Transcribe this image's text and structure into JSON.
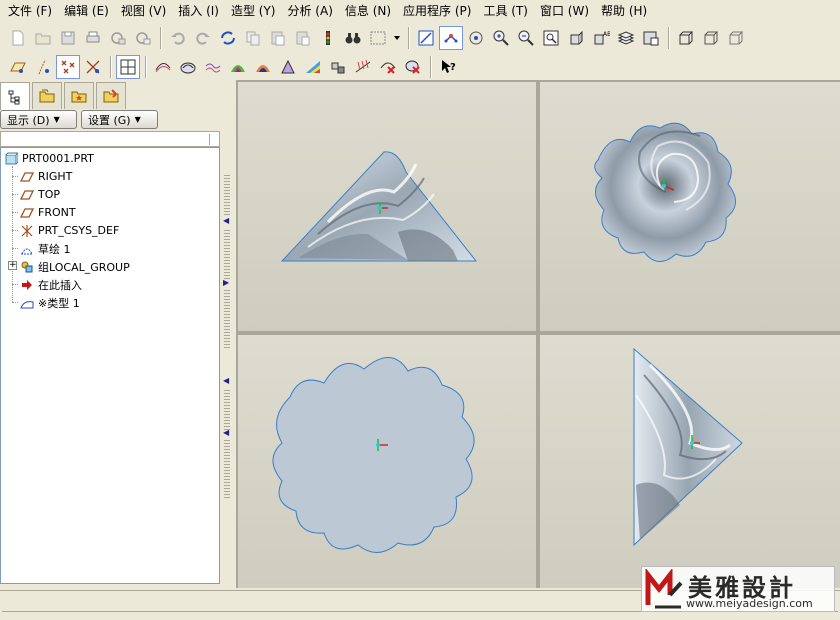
{
  "menu": [
    "文件 (F)",
    "编辑 (E)",
    "视图 (V)",
    "插入 (I)",
    "造型 (Y)",
    "分析 (A)",
    "信息 (N)",
    "应用程序 (P)",
    "工具 (T)",
    "窗口 (W)",
    "帮助 (H)"
  ],
  "panel": {
    "show_button": "显示 (D)",
    "settings_button": "设置 (G)"
  },
  "tree": {
    "items": [
      {
        "label": "PRT0001.PRT",
        "icon": "part-icon"
      },
      {
        "label": "RIGHT",
        "icon": "datum-plane-icon"
      },
      {
        "label": "TOP",
        "icon": "datum-plane-icon"
      },
      {
        "label": "FRONT",
        "icon": "datum-plane-icon"
      },
      {
        "label": "PRT_CSYS_DEF",
        "icon": "csys-icon"
      },
      {
        "label": "草绘 1",
        "icon": "sketch-icon"
      },
      {
        "label": "组LOCAL_GROUP",
        "icon": "group-icon"
      },
      {
        "label": "在此插入",
        "icon": "insert-here-arrow-icon"
      },
      {
        "label": "※类型 1",
        "icon": "style-feature-icon"
      }
    ]
  },
  "colors": {
    "surface": "#b4c0cc",
    "surface_dark": "#5f6a74",
    "edge": "#3a7fc8",
    "viewport_bg": "#d6d4c7"
  },
  "logo": {
    "title": "美雅設計",
    "url": "www.meiyadesign.com"
  }
}
